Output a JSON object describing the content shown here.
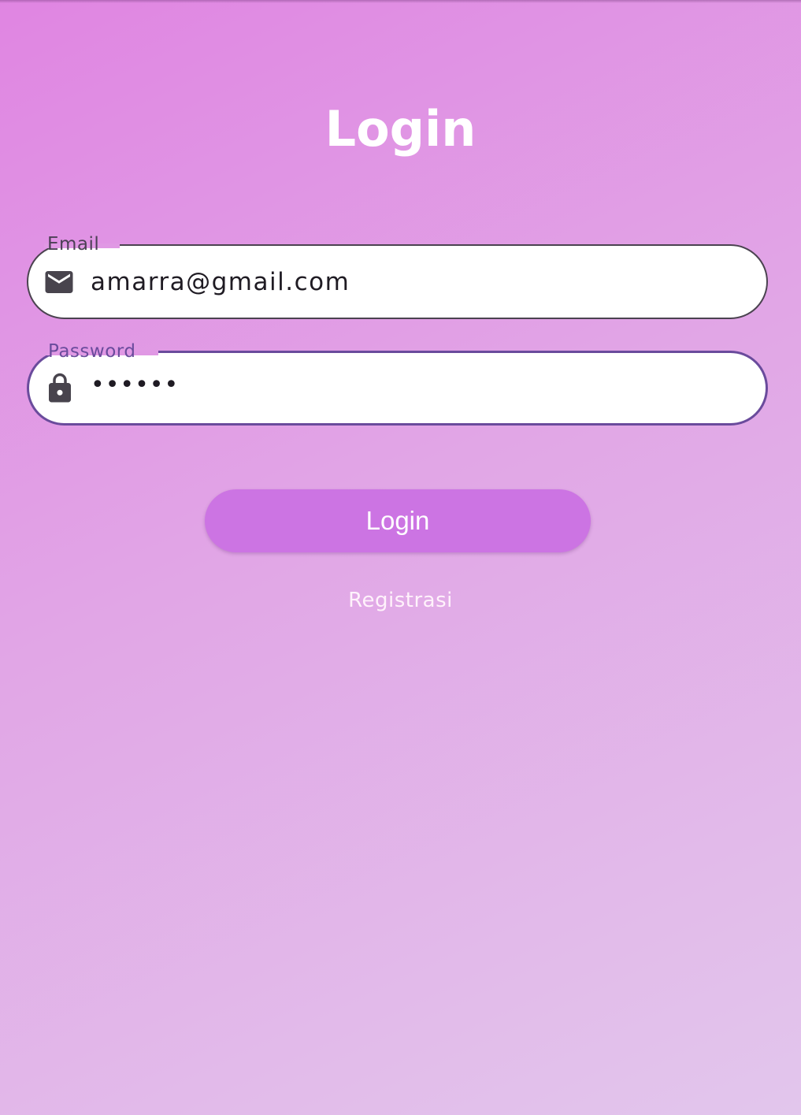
{
  "page": {
    "title": "Login"
  },
  "form": {
    "email": {
      "label": "Email",
      "value": "amarra@gmail.com",
      "icon": "mail-icon"
    },
    "password": {
      "label": "Password",
      "value": "••••••",
      "icon": "lock-icon"
    }
  },
  "actions": {
    "login_label": "Login",
    "register_label": "Registrasi"
  },
  "colors": {
    "gradient_start": "#e085e2",
    "gradient_end": "#e2c6ec",
    "button": "#cc74e3",
    "focused_border": "#6a4b9c",
    "field_background": "#ffffff"
  }
}
